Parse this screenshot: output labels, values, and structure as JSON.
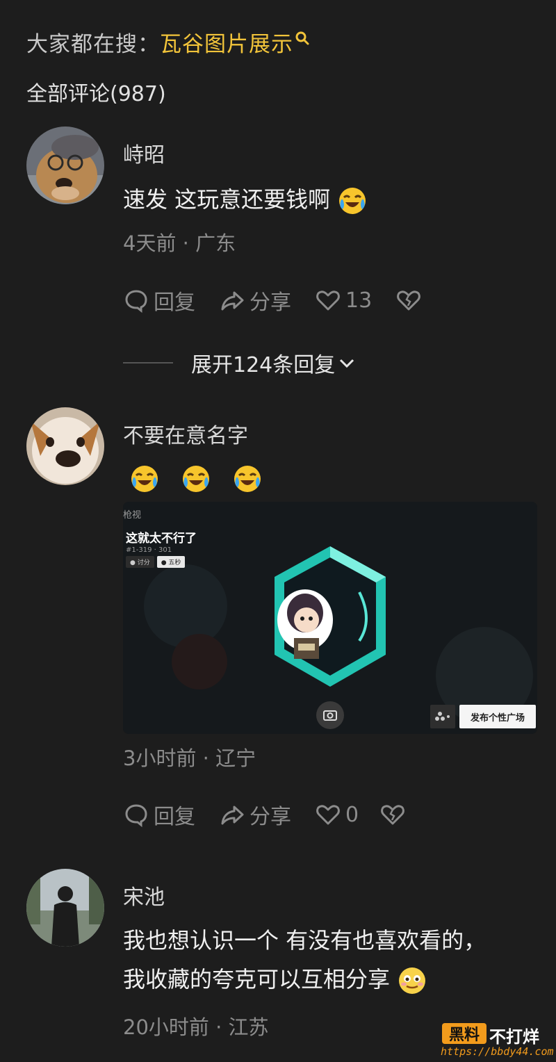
{
  "search": {
    "label": "大家都在搜：",
    "term": "瓦谷图片展示",
    "icon": "search-icon"
  },
  "comments_header": {
    "label": "全部评论(987)"
  },
  "comments": [
    {
      "author": "峙昭",
      "text": "速发 这玩意还要钱啊",
      "emoji": "laughing-crying-emoji",
      "meta": "4天前 · 广东",
      "actions": {
        "reply": "回复",
        "share": "分享",
        "likes": "13"
      },
      "expand_replies": "展开124条回复"
    },
    {
      "author": "不要在意名字",
      "emojis": [
        "laughing-crying-emoji",
        "laughing-crying-emoji",
        "laughing-crying-emoji"
      ],
      "screenshot": {
        "top_label": "枪视",
        "title": "这就太不行了",
        "id_text": "#1-319 · 301",
        "btn_1": "● 讨分",
        "btn_2": "● 五秒",
        "publish": "发布个性广场"
      },
      "meta": "3小时前 · 辽宁",
      "actions": {
        "reply": "回复",
        "share": "分享",
        "likes": "0"
      }
    },
    {
      "author": "宋池",
      "text_line1": "我也想认识一个  有没有也喜欢看的，",
      "text_line2": "我收藏的夸克可以互相分享",
      "emoji": "shy-smile-emoji",
      "meta": "20小时前 · 江苏"
    }
  ],
  "watermark": {
    "badge": "黑料",
    "text": "不打烊",
    "url": "https://bbdy44.com"
  },
  "colors": {
    "background": "#1d1d1d",
    "accent": "#f2c43a",
    "muted": "#8c8c8c",
    "watermark": "#f29b1c"
  }
}
